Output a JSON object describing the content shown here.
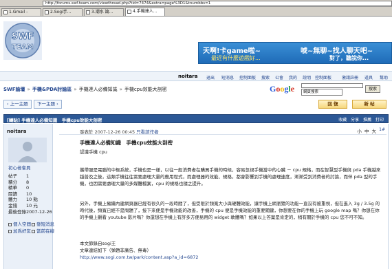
{
  "browser": {
    "address": "http://forums.swf-team.com/viewthread.php?tid=7474&extra=page%3D1&tnumbbs=1",
    "tabs": [
      {
        "label": "1.Gmail -"
      },
      {
        "label": "2.Sogi手..."
      },
      {
        "label": "3.潮水 論..."
      },
      {
        "label": "4.手機達人..."
      }
    ]
  },
  "site": {
    "logo_text": "SWF TEAM",
    "ad": {
      "line1_left": "天啊!卡game啦~",
      "line2_left": "最近有什麼遊戲好...",
      "line1_right": "唬~無聊~找人聊天吧~",
      "line2_right": "對了，聽說你..."
    }
  },
  "topnav": {
    "username": "noitara",
    "items": [
      "退出",
      "短消息",
      "控制面板",
      "搜索",
      "公會",
      "我的",
      "說明",
      "控制面板",
      "",
      "激請註冊",
      "道具",
      "幫助"
    ]
  },
  "breadcrumb": {
    "items": [
      "SWF論壇",
      "手機&PDA討論區",
      "手機達人必備知識",
      "手機cpu效能大剖密"
    ]
  },
  "search": {
    "logo_g": "G",
    "logo_o1": "o",
    "logo_o2": "o",
    "logo_g2": "g",
    "logo_l": "l",
    "logo_e": "e",
    "select_value": "網頁搜索",
    "button": "搜索"
  },
  "pager": {
    "prev": "‹ 上一主題",
    "next": "下一主題 ›",
    "reply": "回 復",
    "new_post": "新 帖"
  },
  "thread": {
    "header_title": "[轉貼] 手機達人必備知識　手機cpu效能大剖密",
    "header_ops": "收藏 分享 推薦 打印"
  },
  "post": {
    "author": "noitara",
    "rank": "初心者會員",
    "stats": [
      {
        "label": "帖子",
        "value": "1"
      },
      {
        "label": "積分",
        "value": "8"
      },
      {
        "label": "精華",
        "value": "0"
      },
      {
        "label": "閱讀",
        "value": "10"
      },
      {
        "label": "體力",
        "value": "10 點"
      },
      {
        "label": "金錢",
        "value": "10 元"
      },
      {
        "label": "最後登錄",
        "value": "2007-12-26"
      }
    ],
    "links": [
      "個人空間",
      "發短消息",
      "加爲好友",
      "當前在線"
    ],
    "meta": "發表於 2007-12-26 00:45",
    "meta_author_only": "只看該作者",
    "font_ctl": "小 中 大",
    "floor": "1#",
    "title": "手機達人必備知識　手機cpu效能大剖密",
    "subtitle": "認識手機 cpu",
    "p1": "攜帶服是電腦的中樞系統，手機也是一樣，以往一般消費者在購買手機的時候，容易忽視手機當中的心臟 － cpu 規格，而在智慧型手機與 pda 手機越來越普及之後，這類手機往往需要處理大量的應用程式，而處理器的效能、規格，都會影響到手機的處理速度，漸漸受到消費者的討論，而伴 pda 型的手機，也因需要處理大量的多媒體檔案，cpu 的規格也隨之提升。",
    "p2": "另外，手機上擁續內建網頁器已經有很久的一段時間了，但受限於頻寬大小與硬體效能，讓手機上網瀏覽的功能一直沒有被重視，但在進入 3g / 3.5g 的時代後，頻寬已經不是問題了，接下來便是手機效能的改善，手機的 cpu 便是手機效能的重要關鍵，你想要在你的手機上玩 google map 嗎？你想在你的手機上觀看 youtube 影片嗎？你還想在手機上有許多方便易用的 widget 軟體嗎？如果以上答案是肯定的，稍有關於手機的 cpu 您不可不知。",
    "source_line1": "本文節錄自sogi王",
    "source_line2": "文章連結如下（弹題非廣告、無毒）",
    "source_url": "http://www.sogi.com.tw/park/content.asp?a_id=6872"
  }
}
